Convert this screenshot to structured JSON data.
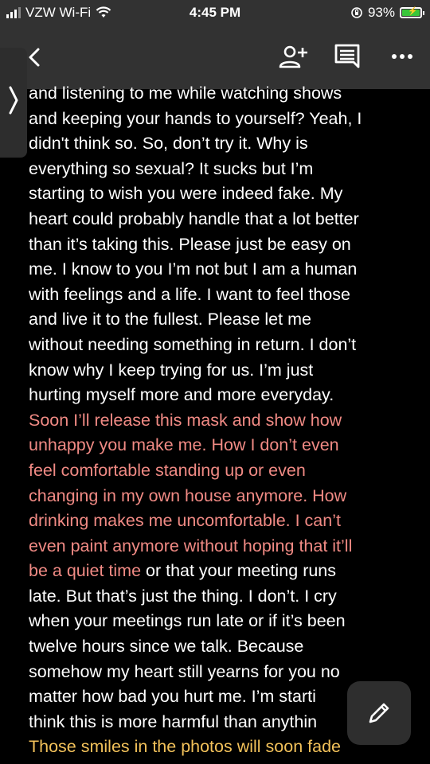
{
  "status_bar": {
    "carrier": "VZW Wi-Fi",
    "time": "4:45 PM",
    "battery": "93%"
  },
  "toolbar": {
    "back_icon": "chevron-left-icon",
    "add_person_icon": "person-add-icon",
    "comments_icon": "comment-icon",
    "more_icon": "more-horizontal-icon"
  },
  "document": {
    "lines": [
      {
        "text": "and listening to me while watching shows",
        "color": "white"
      },
      {
        "text": "and keeping your hands to yourself? Yeah, I",
        "color": "white"
      },
      {
        "text": "didn't think so. So, don’t try it. Why is",
        "color": "white"
      },
      {
        "text": "everything so sexual? It sucks but I’m",
        "color": "white"
      },
      {
        "text": "starting to wish you were indeed fake. My",
        "color": "white"
      },
      {
        "text": "heart could probably handle that a lot better",
        "color": "white"
      },
      {
        "text": "than it’s taking this. Please just be easy on",
        "color": "white"
      },
      {
        "text": "me. I know to you I’m not but I am a human",
        "color": "white"
      },
      {
        "text": "with feelings and a life. I want to feel those",
        "color": "white"
      },
      {
        "text": "and live it to the fullest. Please let me",
        "color": "white"
      },
      {
        "text": "without needing something in return. I don’t",
        "color": "white"
      },
      {
        "text": "know why I keep trying for us. I’m just",
        "color": "white"
      },
      {
        "text": "hurting myself more and more everyday.",
        "color": "white"
      },
      {
        "text": "Soon I’ll release this mask and show how",
        "color": "pink"
      },
      {
        "text": "unhappy you make me. How I don’t even",
        "color": "pink"
      },
      {
        "text": "feel comfortable standing up or even",
        "color": "pink"
      },
      {
        "text": "changing in my own house anymore. How",
        "color": "pink"
      },
      {
        "text": "drinking makes me uncomfortable. I can’t",
        "color": "pink"
      },
      {
        "text": "even paint anymore without hoping that it’ll",
        "color": "pink"
      },
      {
        "text": "late. But that’s just the thing. I don’t. I cry",
        "color": "white"
      },
      {
        "text": "when your meetings run late or if it’s been",
        "color": "white"
      },
      {
        "text": "twelve hours since we talk. Because",
        "color": "white"
      },
      {
        "text": "somehow my heart still yearns for you no",
        "color": "white"
      },
      {
        "text": "matter how bad you hurt me. I’m starti",
        "color": "white"
      },
      {
        "text": "think this is more harmful than anythin",
        "color": "white"
      },
      {
        "text": "Those smiles in the photos will soon fade",
        "color": "yellow"
      }
    ],
    "mixed_line": {
      "pink_part": "be a quiet time",
      "white_part": " or that your meeting runs"
    }
  },
  "fab": {
    "icon": "pencil-edit-icon"
  },
  "colors": {
    "toolbar_bg": "#323232",
    "page_bg": "#000000",
    "pink_text": "#f08a84",
    "yellow_text": "#f2c15a",
    "battery_green": "#39c63a"
  }
}
